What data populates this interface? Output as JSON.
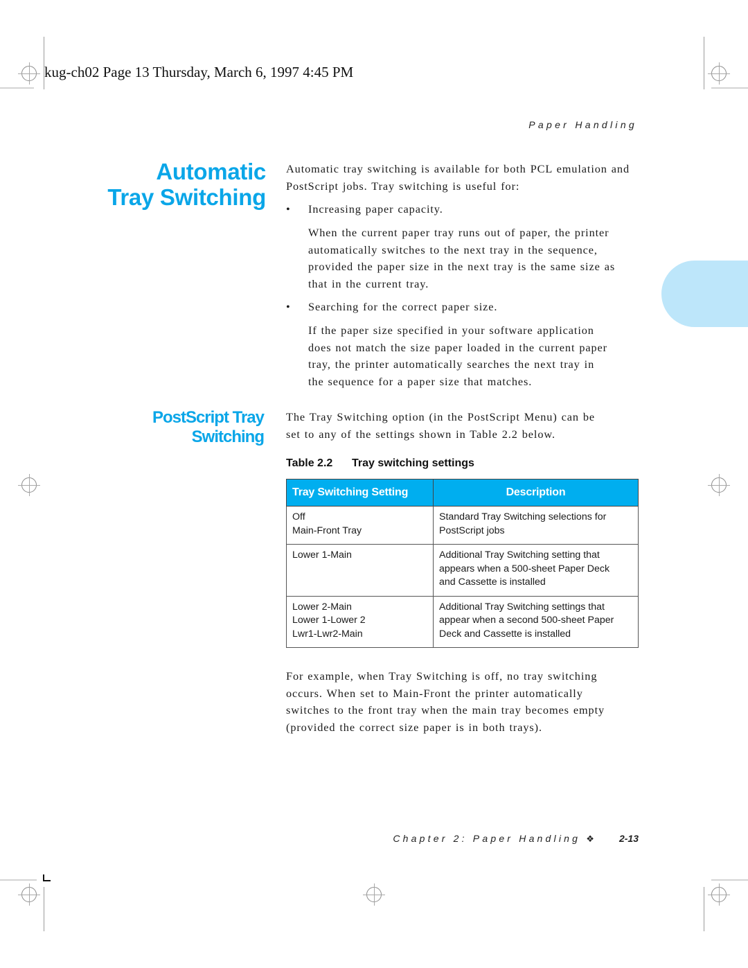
{
  "slug": {
    "text": "kug-ch02  Page 13  Thursday, March 6, 1997  4:45 PM"
  },
  "running_head": "Paper Handling",
  "section1": {
    "heading_lines": [
      "Automatic",
      "Tray Switching"
    ],
    "intro": "Automatic tray switching is available for both PCL emulation and PostScript jobs. Tray switching is useful for:",
    "bullets": [
      {
        "marker": "•",
        "label": "Increasing paper capacity.",
        "detail_lines": [
          "When the current paper tray runs out of paper, the printer",
          "automatically switches to the next tray in the sequence,",
          "provided the paper size in the next tray is the same size as",
          "that in the current tray."
        ]
      },
      {
        "marker": "•",
        "label": "Searching for the correct paper size.",
        "detail_lines": [
          "If the paper size specified in your software application",
          "does not match the size paper loaded in the current paper",
          "tray, the printer automatically searches the next tray in",
          "the sequence for a paper size that matches."
        ]
      }
    ]
  },
  "section2": {
    "heading_lines": [
      "PostScript Tray",
      "Switching"
    ],
    "intro_lines": [
      "The Tray Switching option (in the PostScript Menu) can be",
      "set to any of the settings shown in Table 2.2 below."
    ],
    "table": {
      "caption_number": "Table 2.2",
      "caption_title": "Tray switching settings",
      "headers": [
        "Tray Switching Setting",
        "Description"
      ],
      "rows": [
        {
          "setting_lines": [
            "Off",
            "Main-Front Tray"
          ],
          "description_lines": [
            "Standard Tray Switching selections for",
            "PostScript jobs"
          ]
        },
        {
          "setting_lines": [
            "Lower 1-Main"
          ],
          "description_lines": [
            "Additional Tray Switching setting that",
            "appears when a 500-sheet Paper Deck",
            "and Cassette is installed"
          ]
        },
        {
          "setting_lines": [
            "Lower 2-Main",
            "Lower 1-Lower 2",
            "Lwr1-Lwr2-Main"
          ],
          "description_lines": [
            "Additional Tray Switching settings that",
            "appear when a second 500-sheet Paper",
            "Deck and Cassette is installed"
          ]
        }
      ]
    },
    "example_lines": [
      "For example, when Tray Switching is off, no tray switching",
      "occurs. When set to Main-Front the printer automatically",
      "switches to the front tray when the main tray becomes empty",
      "(provided the correct size paper is in both trays)."
    ]
  },
  "footer": {
    "chapter": "Chapter 2: Paper Handling",
    "separator_icon": "❖",
    "page_number": "2-13"
  },
  "colors": {
    "heading_blue": "#0aa6e8",
    "table_header_bg": "#00aeef",
    "thumb_tab": "#bde6fa"
  }
}
